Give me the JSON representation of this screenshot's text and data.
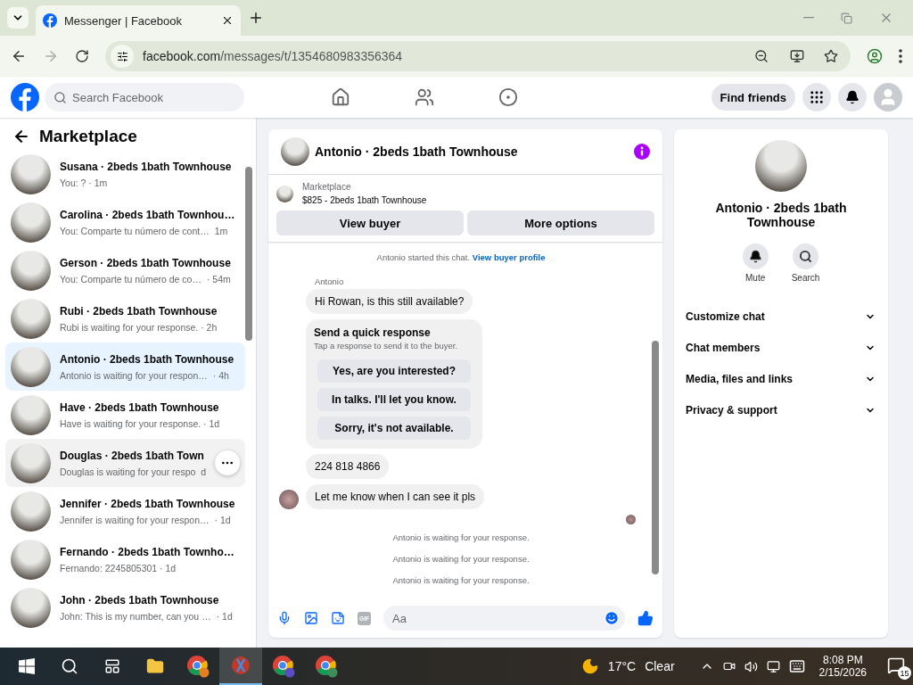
{
  "browser": {
    "tab_title": "Messenger | Facebook",
    "url_host": "facebook.com",
    "url_path": "/messages/t/1354680983356364"
  },
  "topbar": {
    "search_placeholder": "Search Facebook",
    "find_friends": "Find friends"
  },
  "sidebar": {
    "title": "Marketplace",
    "conversations": [
      {
        "name": "Susana · 2beds 1bath Townhouse",
        "preview": "You: ? · 1m",
        "selected": false,
        "hovered": false
      },
      {
        "name": "Carolina · 2beds 1bath Townhou…",
        "preview": "You: Comparte tu número de cont…",
        "time": "1m",
        "selected": false,
        "hovered": false
      },
      {
        "name": "Gerson · 2beds 1bath Townhouse",
        "preview": "You: Comparte tu número de co…",
        "time": "· 54m",
        "selected": false,
        "hovered": false
      },
      {
        "name": "Rubi · 2beds 1bath Townhouse",
        "preview": "Rubi is waiting for your response. · 2h",
        "selected": false,
        "hovered": false
      },
      {
        "name": "Antonio · 2beds 1bath Townhouse",
        "preview": "Antonio is waiting for your respon…",
        "time": "· 4h",
        "selected": true,
        "hovered": false
      },
      {
        "name": "Have · 2beds 1bath Townhouse",
        "preview": "Have is waiting for your response. · 1d",
        "selected": false,
        "hovered": false
      },
      {
        "name": "Douglas · 2beds 1bath Town",
        "preview": "Douglas is waiting for your respo",
        "time": "d",
        "selected": false,
        "hovered": true
      },
      {
        "name": "Jennifer · 2beds 1bath Townhouse",
        "preview": "Jennifer is waiting for your respon…",
        "time": "· 1d",
        "selected": false,
        "hovered": false
      },
      {
        "name": "Fernando · 2beds 1bath Townho…",
        "preview": "Fernando: 2245805301 · 1d",
        "selected": false,
        "hovered": false
      },
      {
        "name": "John · 2beds 1bath Townhouse",
        "preview": "John: This is my number, can you …",
        "time": "· 1d",
        "selected": false,
        "hovered": false
      }
    ]
  },
  "chat": {
    "title": "Antonio · 2beds 1bath Townhouse",
    "listing": {
      "label": "Marketplace",
      "item": "$825 - 2beds 1bath Townhouse"
    },
    "buttons": [
      "View buyer",
      "More options"
    ],
    "messages": [
      {
        "kind": "system",
        "text": "Antonio started this chat.",
        "link": "View buyer profile"
      },
      {
        "kind": "sender",
        "text": "Antonio"
      },
      {
        "kind": "bubble",
        "text": "Hi Rowan, is this still available?",
        "avatar": false
      },
      {
        "kind": "quick",
        "title": "Send a quick response",
        "subtitle": "Tap a response to send it to the buyer.",
        "options": [
          "Yes, are you interested?",
          "In talks. I'll let you know.",
          "Sorry, it's not available."
        ]
      },
      {
        "kind": "bubble",
        "text": "224 818 4866",
        "avatar": false
      },
      {
        "kind": "bubble",
        "text": "Let me know when I can see it pls",
        "avatar": true
      },
      {
        "kind": "seen"
      },
      {
        "kind": "system",
        "text": "Antonio is waiting for your response."
      },
      {
        "kind": "system",
        "text": "Antonio is waiting for your response."
      },
      {
        "kind": "system",
        "text": "Antonio is waiting for your response."
      }
    ],
    "composer": {
      "gif_label": "GIF",
      "placeholder": "Aa"
    }
  },
  "info": {
    "title": "Antonio · 2beds 1bath Townhouse",
    "actions": [
      {
        "kind": "mute",
        "label": "Mute"
      },
      {
        "kind": "search",
        "label": "Search"
      }
    ],
    "sections": [
      "Customize chat",
      "Chat members",
      "Media, files and links",
      "Privacy & support"
    ]
  },
  "taskbar": {
    "temperature": "17°C",
    "weather": "Clear",
    "time": "8:08 PM",
    "date": "2/15/2026",
    "notifications": "15"
  }
}
